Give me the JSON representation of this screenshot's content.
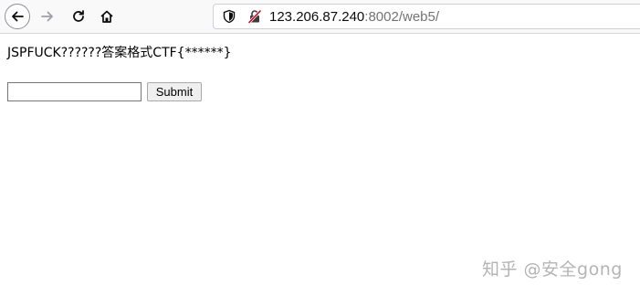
{
  "browser": {
    "url_host": "123.206.87.240",
    "url_path": ":8002/web5/"
  },
  "page": {
    "prompt": "JSPFUCK??????答案格式CTF{******}",
    "input_value": "",
    "submit_label": "Submit"
  },
  "watermark": {
    "text": "知乎 @安全gong"
  },
  "icons": {
    "back": "back-arrow-icon",
    "forward": "forward-arrow-icon",
    "reload": "reload-icon",
    "home": "home-icon",
    "shield": "tracking-shield-icon",
    "insecure": "insecure-lock-icon"
  },
  "colors": {
    "toolbar_bg": "#f9f9fa",
    "insecure_lock": "#d70022",
    "url_host": "#0c0c0d",
    "url_path": "#737373",
    "watermark": "#b4b4b4"
  }
}
